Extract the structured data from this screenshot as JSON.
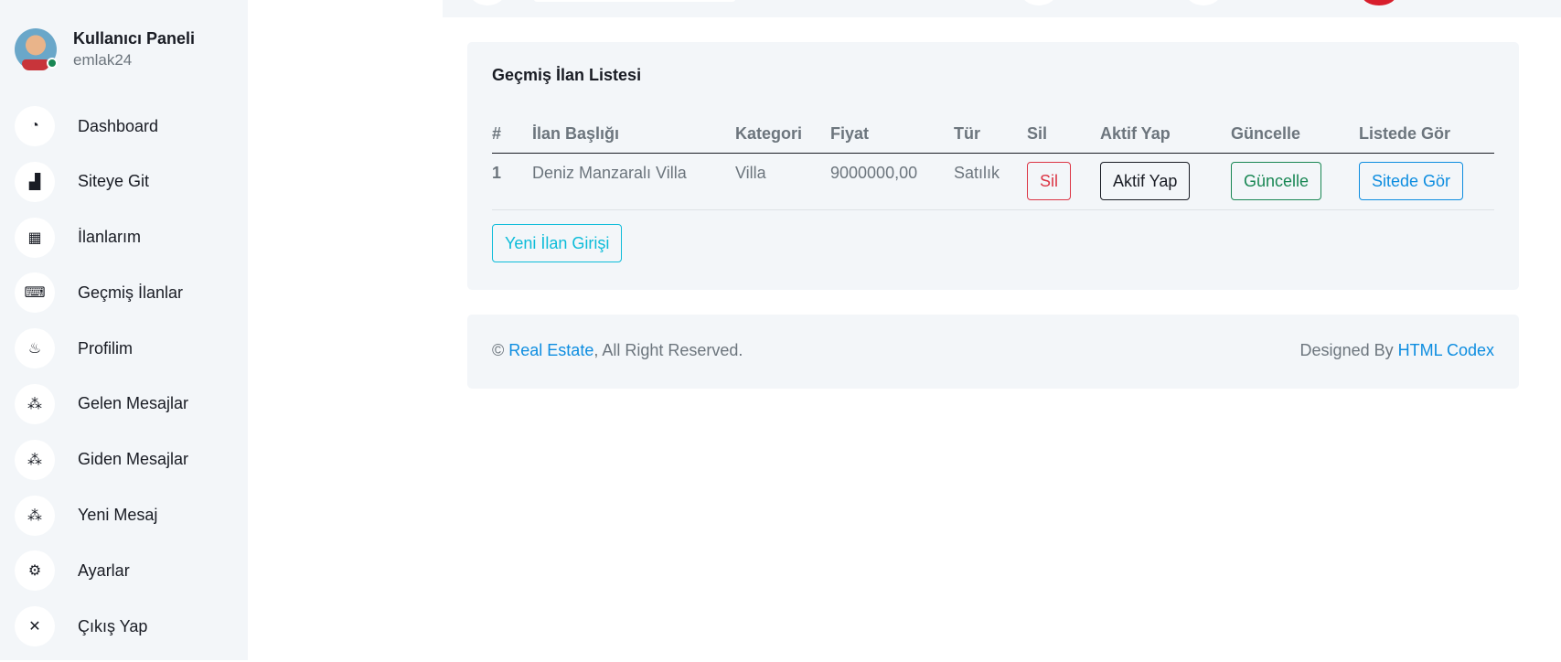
{
  "sidebar": {
    "profile": {
      "title": "Kullanıcı Paneli",
      "username": "emlak24"
    },
    "items": [
      {
        "label": "Dashboard",
        "icon": "gauge-icon",
        "glyph": "◔"
      },
      {
        "label": "Siteye Git",
        "icon": "bar-chart-icon",
        "glyph": "▟"
      },
      {
        "label": "İlanlarım",
        "icon": "grid-icon",
        "glyph": "▦"
      },
      {
        "label": "Geçmiş İlanlar",
        "icon": "keyboard-icon",
        "glyph": "⌨"
      },
      {
        "label": "Profilim",
        "icon": "cake-icon",
        "glyph": "♨"
      },
      {
        "label": "Gelen Mesajlar",
        "icon": "cubes-icon",
        "glyph": "⁂"
      },
      {
        "label": "Giden Mesajlar",
        "icon": "cubes-icon",
        "glyph": "⁂"
      },
      {
        "label": "Yeni Mesaj",
        "icon": "cubes-icon",
        "glyph": "⁂"
      },
      {
        "label": "Ayarlar",
        "icon": "gear-icon",
        "glyph": "⚙"
      },
      {
        "label": "Çıkış Yap",
        "icon": "close-icon",
        "glyph": "✕"
      }
    ]
  },
  "main": {
    "card_title": "Geçmiş İlan Listesi",
    "table": {
      "headers": [
        "#",
        "İlan Başlığı",
        "Kategori",
        "Fiyat",
        "Tür",
        "Sil",
        "Aktif Yap",
        "Güncelle",
        "Listede Gör"
      ],
      "rows": [
        {
          "num": "1",
          "title": "Deniz Manzaralı Villa",
          "category": "Villa",
          "price": "9000000,00",
          "type": "Satılık",
          "delete_label": "Sil",
          "activate_label": "Aktif Yap",
          "update_label": "Güncelle",
          "view_label": "Sitede Gör"
        }
      ]
    },
    "new_button_label": "Yeni İlan Girişi"
  },
  "footer": {
    "copyright_symbol": "©",
    "brand": "Real Estate",
    "rights": ", All Right Reserved.",
    "designed_by": "Designed By",
    "designer": "HTML Codex"
  },
  "colors": {
    "sidebar_bg": "#f3f6f9",
    "text_dark": "#191c24",
    "text_muted": "#6c757d",
    "danger": "#dc3545",
    "success": "#198754",
    "primary": "#0d8de0",
    "info": "#0dbcd9",
    "online_status": "#198754"
  }
}
